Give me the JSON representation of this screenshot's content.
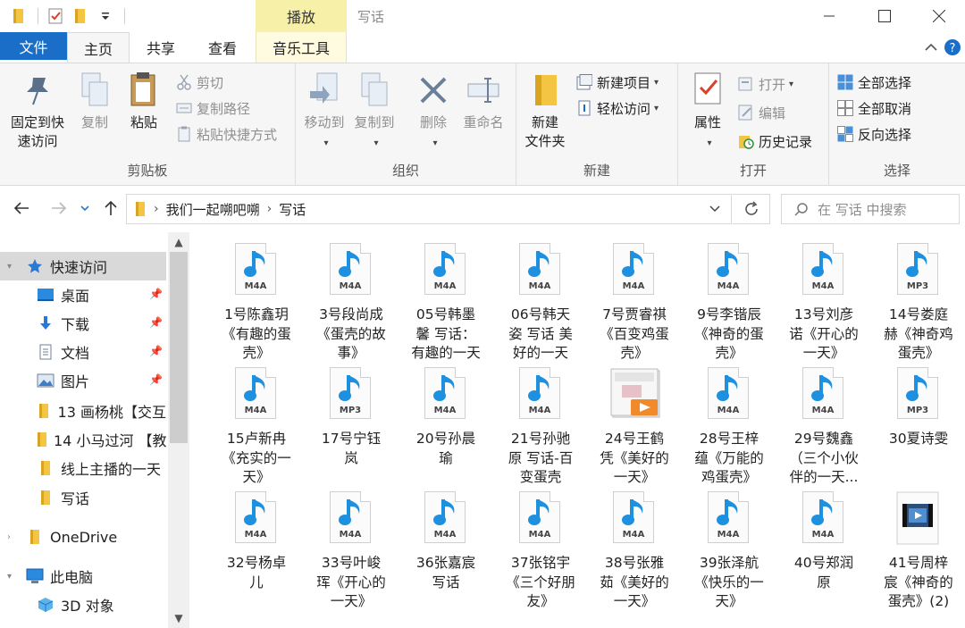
{
  "titlebar": {
    "context_tab": "播放",
    "window_title": "写话"
  },
  "tabs": {
    "file": "文件",
    "home": "主页",
    "share": "共享",
    "view": "查看",
    "music_tools": "音乐工具"
  },
  "ribbon": {
    "clipboard": {
      "label": "剪贴板",
      "pin": "固定到快\n速访问",
      "copy": "复制",
      "paste": "粘贴",
      "cut": "剪切",
      "copy_path": "复制路径",
      "paste_shortcut": "粘贴快捷方式"
    },
    "organize": {
      "label": "组织",
      "move_to": "移动到",
      "copy_to": "复制到",
      "delete": "删除",
      "rename": "重命名"
    },
    "new": {
      "label": "新建",
      "new_folder": "新建\n文件夹",
      "new_item": "新建项目",
      "easy_access": "轻松访问"
    },
    "open": {
      "label": "打开",
      "properties": "属性",
      "open": "打开",
      "edit": "编辑",
      "history": "历史记录"
    },
    "select": {
      "label": "选择",
      "select_all": "全部选择",
      "select_none": "全部取消",
      "invert": "反向选择"
    }
  },
  "address": {
    "crumbs": [
      "我们一起嗍吧嗍",
      "写话"
    ],
    "search_placeholder": "在 写话 中搜索"
  },
  "navpane": {
    "quick_access": "快速访问",
    "desktop": "桌面",
    "downloads": "下载",
    "documents": "文档",
    "pictures": "图片",
    "folder1": "13 画杨桃【交互",
    "folder2": "14 小马过河 【教",
    "folder3": "线上主播的一天",
    "folder4": "写话",
    "onedrive": "OneDrive",
    "this_pc": "此电脑",
    "objects3d": "3D 对象"
  },
  "files": [
    {
      "name": "1号陈鑫玥《有趣的蛋壳》",
      "lines": [
        "1号陈鑫玥",
        "《有趣的蛋",
        "壳》"
      ],
      "ext": "M4A",
      "icon": "audio-icon"
    },
    {
      "name": "3号段尚成《蛋壳的故事》",
      "lines": [
        "3号段尚成",
        "《蛋壳的故",
        "事》"
      ],
      "ext": "M4A",
      "icon": "audio-icon"
    },
    {
      "name": "05号韩墨馨 写话：有趣的一天",
      "lines": [
        "05号韩墨",
        "馨 写话：",
        "有趣的一天"
      ],
      "ext": "M4A",
      "icon": "audio-icon"
    },
    {
      "name": "06号韩天姿 写话 美好的一天",
      "lines": [
        "06号韩天",
        "姿 写话 美",
        "好的一天"
      ],
      "ext": "M4A",
      "icon": "audio-icon"
    },
    {
      "name": "7号贾睿祺《百变鸡蛋壳》",
      "lines": [
        "7号贾睿祺",
        "《百变鸡蛋",
        "壳》"
      ],
      "ext": "M4A",
      "icon": "audio-icon"
    },
    {
      "name": "9号李锴辰《神奇的蛋壳》",
      "lines": [
        "9号李锴辰",
        "《神奇的蛋",
        "壳》"
      ],
      "ext": "M4A",
      "icon": "audio-icon"
    },
    {
      "name": "13号刘彦诺《开心的一天》",
      "lines": [
        "13号刘彦",
        "诺《开心的",
        "一天》"
      ],
      "ext": "M4A",
      "icon": "audio-icon"
    },
    {
      "name": "14号娄庭赫《神奇鸡蛋壳》",
      "lines": [
        "14号娄庭",
        "赫《神奇鸡",
        "蛋壳》"
      ],
      "ext": "MP3",
      "icon": "audio-icon"
    },
    {
      "name": "15卢新冉《充实的一天》",
      "lines": [
        "15卢新冉",
        "《充实的一",
        "天》"
      ],
      "ext": "M4A",
      "icon": "audio-icon"
    },
    {
      "name": "17号宁钰岚",
      "lines": [
        "17号宁钰",
        "岚"
      ],
      "ext": "MP3",
      "icon": "audio-icon"
    },
    {
      "name": "20号孙晨瑜",
      "lines": [
        "20号孙晨",
        "瑜"
      ],
      "ext": "M4A",
      "icon": "audio-icon"
    },
    {
      "name": "21号孙驰原 写话-百变蛋壳",
      "lines": [
        "21号孙驰",
        "原 写话-百",
        "变蛋壳"
      ],
      "ext": "M4A",
      "icon": "audio-icon"
    },
    {
      "name": "24号王鹤凭《美好的一天》",
      "lines": [
        "24号王鹤",
        "凭《美好的",
        "一天》"
      ],
      "ext": "",
      "icon": "video-thumbnail-icon"
    },
    {
      "name": "28号王梓蕴《万能的鸡蛋壳》",
      "lines": [
        "28号王梓",
        "蕴《万能的",
        "鸡蛋壳》"
      ],
      "ext": "M4A",
      "icon": "audio-icon"
    },
    {
      "name": "29号魏鑫（三个小伙伴的一天...",
      "lines": [
        "29号魏鑫",
        "（三个小伙",
        "伴的一天..."
      ],
      "ext": "M4A",
      "icon": "audio-icon"
    },
    {
      "name": "30夏诗雯",
      "lines": [
        "30夏诗雯"
      ],
      "ext": "MP3",
      "icon": "audio-icon"
    },
    {
      "name": "32号杨卓儿",
      "lines": [
        "32号杨卓",
        "儿"
      ],
      "ext": "M4A",
      "icon": "audio-icon"
    },
    {
      "name": "33号叶峻珲《开心的一天》",
      "lines": [
        "33号叶峻",
        "珲《开心的",
        "一天》"
      ],
      "ext": "M4A",
      "icon": "audio-icon"
    },
    {
      "name": "36张嘉宸写话",
      "lines": [
        "36张嘉宸",
        "写话"
      ],
      "ext": "M4A",
      "icon": "audio-icon"
    },
    {
      "name": "37张铭宇《三个好朋友》",
      "lines": [
        "37张铭宇",
        "《三个好朋",
        "友》"
      ],
      "ext": "M4A",
      "icon": "audio-icon"
    },
    {
      "name": "38号张雅茹《美好的一天》",
      "lines": [
        "38号张雅",
        "茹《美好的",
        "一天》"
      ],
      "ext": "M4A",
      "icon": "audio-icon"
    },
    {
      "name": "39张泽航《快乐的一天》",
      "lines": [
        "39张泽航",
        "《快乐的一",
        "天》"
      ],
      "ext": "M4A",
      "icon": "audio-icon"
    },
    {
      "name": "40号郑润原",
      "lines": [
        "40号郑润",
        "原"
      ],
      "ext": "M4A",
      "icon": "audio-icon"
    },
    {
      "name": "41号周梓宸《神奇的蛋壳》(2)",
      "lines": [
        "41号周梓",
        "宸《神奇的",
        "蛋壳》(2)"
      ],
      "ext": "",
      "icon": "video-file-icon"
    }
  ],
  "colors": {
    "accent": "#1a6ec8",
    "context_tab": "#f7f0a8",
    "folder": "#f4c542",
    "note": "#1e90e0"
  }
}
